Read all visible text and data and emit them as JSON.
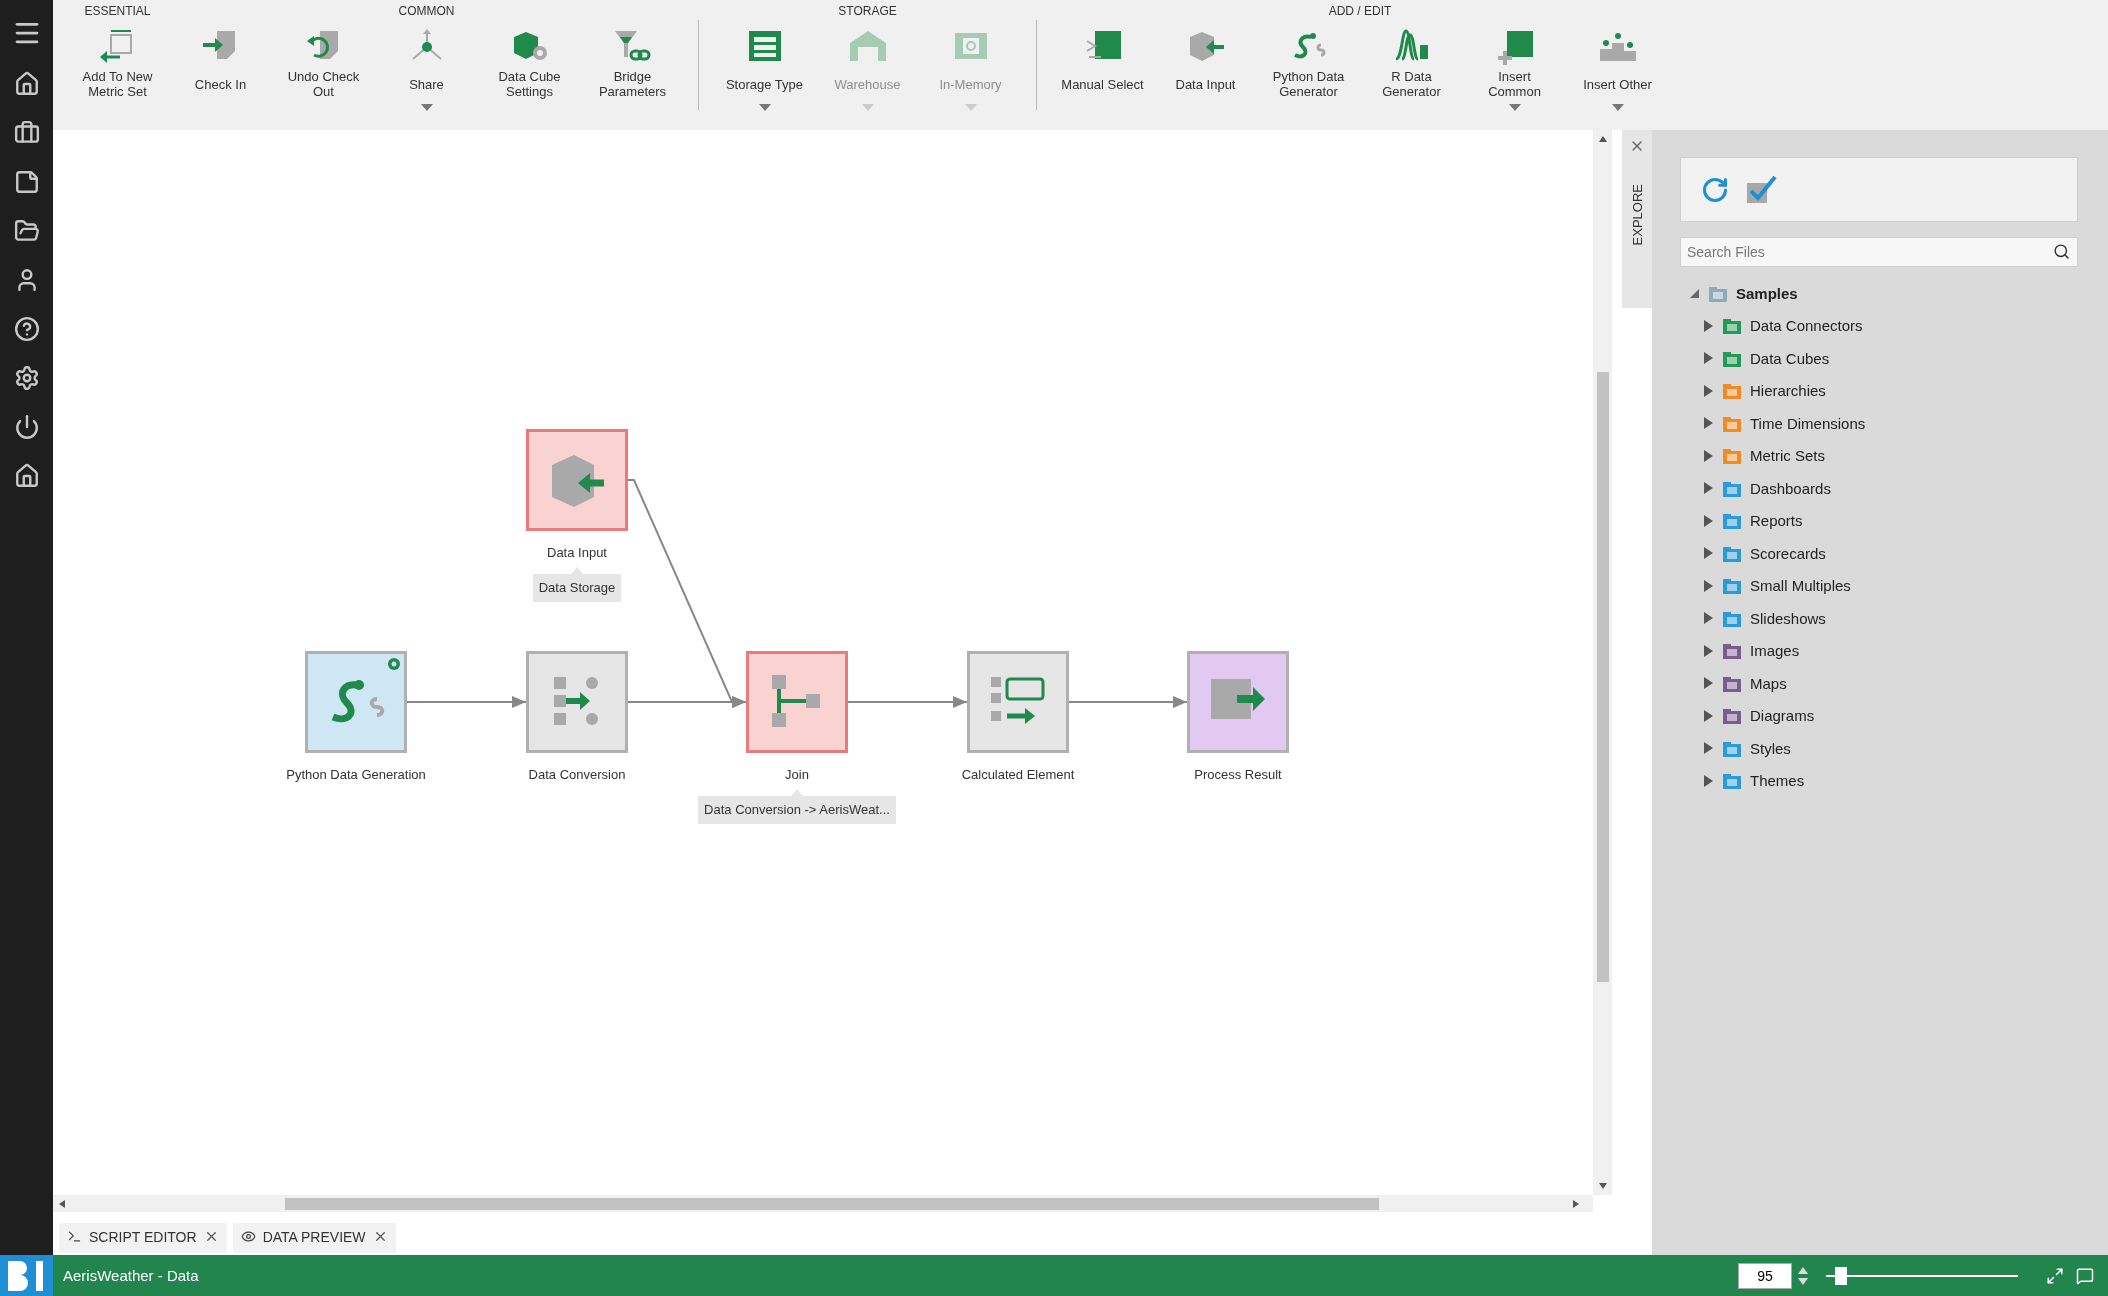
{
  "toolbar": {
    "groups": [
      {
        "label": "ESSENTIAL",
        "separated": false,
        "buttons": [
          {
            "label": "Add To New\nMetric Set",
            "disabled": false,
            "dropdown": false
          }
        ]
      },
      {
        "label": "COMMON",
        "separated": false,
        "buttons": [
          {
            "label": "Check In",
            "disabled": false,
            "dropdown": false
          },
          {
            "label": "Undo Check\nOut",
            "disabled": false,
            "dropdown": false
          },
          {
            "label": "Share",
            "disabled": false,
            "dropdown": true
          },
          {
            "label": "Data Cube\nSettings",
            "disabled": false,
            "dropdown": false
          },
          {
            "label": "Bridge\nParameters",
            "disabled": false,
            "dropdown": false
          }
        ]
      },
      {
        "label": "STORAGE",
        "separated": true,
        "buttons": [
          {
            "label": "Storage Type",
            "disabled": false,
            "dropdown": true
          },
          {
            "label": "Warehouse",
            "disabled": true,
            "dropdown": true
          },
          {
            "label": "In-Memory",
            "disabled": true,
            "dropdown": true
          }
        ]
      },
      {
        "label": "ADD / EDIT",
        "separated": true,
        "buttons": [
          {
            "label": "Manual Select",
            "disabled": false,
            "dropdown": false
          },
          {
            "label": "Data Input",
            "disabled": false,
            "dropdown": false
          },
          {
            "label": "Python Data\nGenerator",
            "disabled": false,
            "dropdown": false
          },
          {
            "label": "R Data\nGenerator",
            "disabled": false,
            "dropdown": false
          },
          {
            "label": "Insert\nCommon",
            "disabled": false,
            "dropdown": true
          },
          {
            "label": "Insert Other",
            "disabled": false,
            "dropdown": true
          }
        ]
      }
    ]
  },
  "canvas": {
    "nodes": [
      {
        "kind": "input",
        "label": "Data Input",
        "error": true,
        "settings_badge": false,
        "note": "Data Storage"
      },
      {
        "kind": "python",
        "label": "Python Data Generation",
        "error": false,
        "color": "#cfe6f5",
        "settings_badge": true
      },
      {
        "kind": "conversion",
        "label": "Data Conversion",
        "error": false,
        "color": "#e6e6e6",
        "settings_badge": false
      },
      {
        "kind": "join",
        "label": "Join",
        "error": true,
        "settings_badge": false,
        "note": "Data Conversion -> AerisWeat..."
      },
      {
        "kind": "calculated",
        "label": "Calculated Element",
        "error": false,
        "color": "#e6e6e6",
        "settings_badge": false
      },
      {
        "kind": "result",
        "label": "Process Result",
        "error": false,
        "color": "#e2c9f2",
        "settings_badge": false
      }
    ]
  },
  "bottom_tabs": [
    {
      "kind": "script",
      "label": "SCRIPT EDITOR",
      "selected": false
    },
    {
      "kind": "preview",
      "label": "DATA PREVIEW",
      "selected": false
    }
  ],
  "explorer": {
    "tab": "EXPLORE",
    "search": {
      "placeholder": "Search Files"
    },
    "tree": [
      {
        "label": "Samples",
        "color": "#8fa9bd",
        "expanded": true,
        "children": [
          {
            "label": "Data Connectors",
            "color": "#239a55",
            "expanded": false
          },
          {
            "label": "Data Cubes",
            "color": "#239a55",
            "expanded": false
          },
          {
            "label": "Hierarchies",
            "color": "#f08a24",
            "expanded": false
          },
          {
            "label": "Time Dimensions",
            "color": "#f08a24",
            "expanded": false
          },
          {
            "label": "Metric Sets",
            "color": "#f08a24",
            "expanded": false
          },
          {
            "label": "Dashboards",
            "color": "#2b9ad8",
            "expanded": false
          },
          {
            "label": "Reports",
            "color": "#2b9ad8",
            "expanded": false
          },
          {
            "label": "Scorecards",
            "color": "#2b9ad8",
            "expanded": false
          },
          {
            "label": "Small Multiples",
            "color": "#2b9ad8",
            "expanded": false
          },
          {
            "label": "Slideshows",
            "color": "#2b9ad8",
            "expanded": false
          },
          {
            "label": "Images",
            "color": "#7a5c8e",
            "expanded": false
          },
          {
            "label": "Maps",
            "color": "#7a5c8e",
            "expanded": false
          },
          {
            "label": "Diagrams",
            "color": "#7a5c8e",
            "expanded": false
          },
          {
            "label": "Styles",
            "color": "#2b9ad8",
            "expanded": false
          },
          {
            "label": "Themes",
            "color": "#2b9ad8",
            "expanded": false
          }
        ]
      }
    ]
  },
  "status_bar": {
    "title": "AerisWeather - Data",
    "zoom": "95",
    "zoom_slider": {
      "level": 0.08
    }
  }
}
